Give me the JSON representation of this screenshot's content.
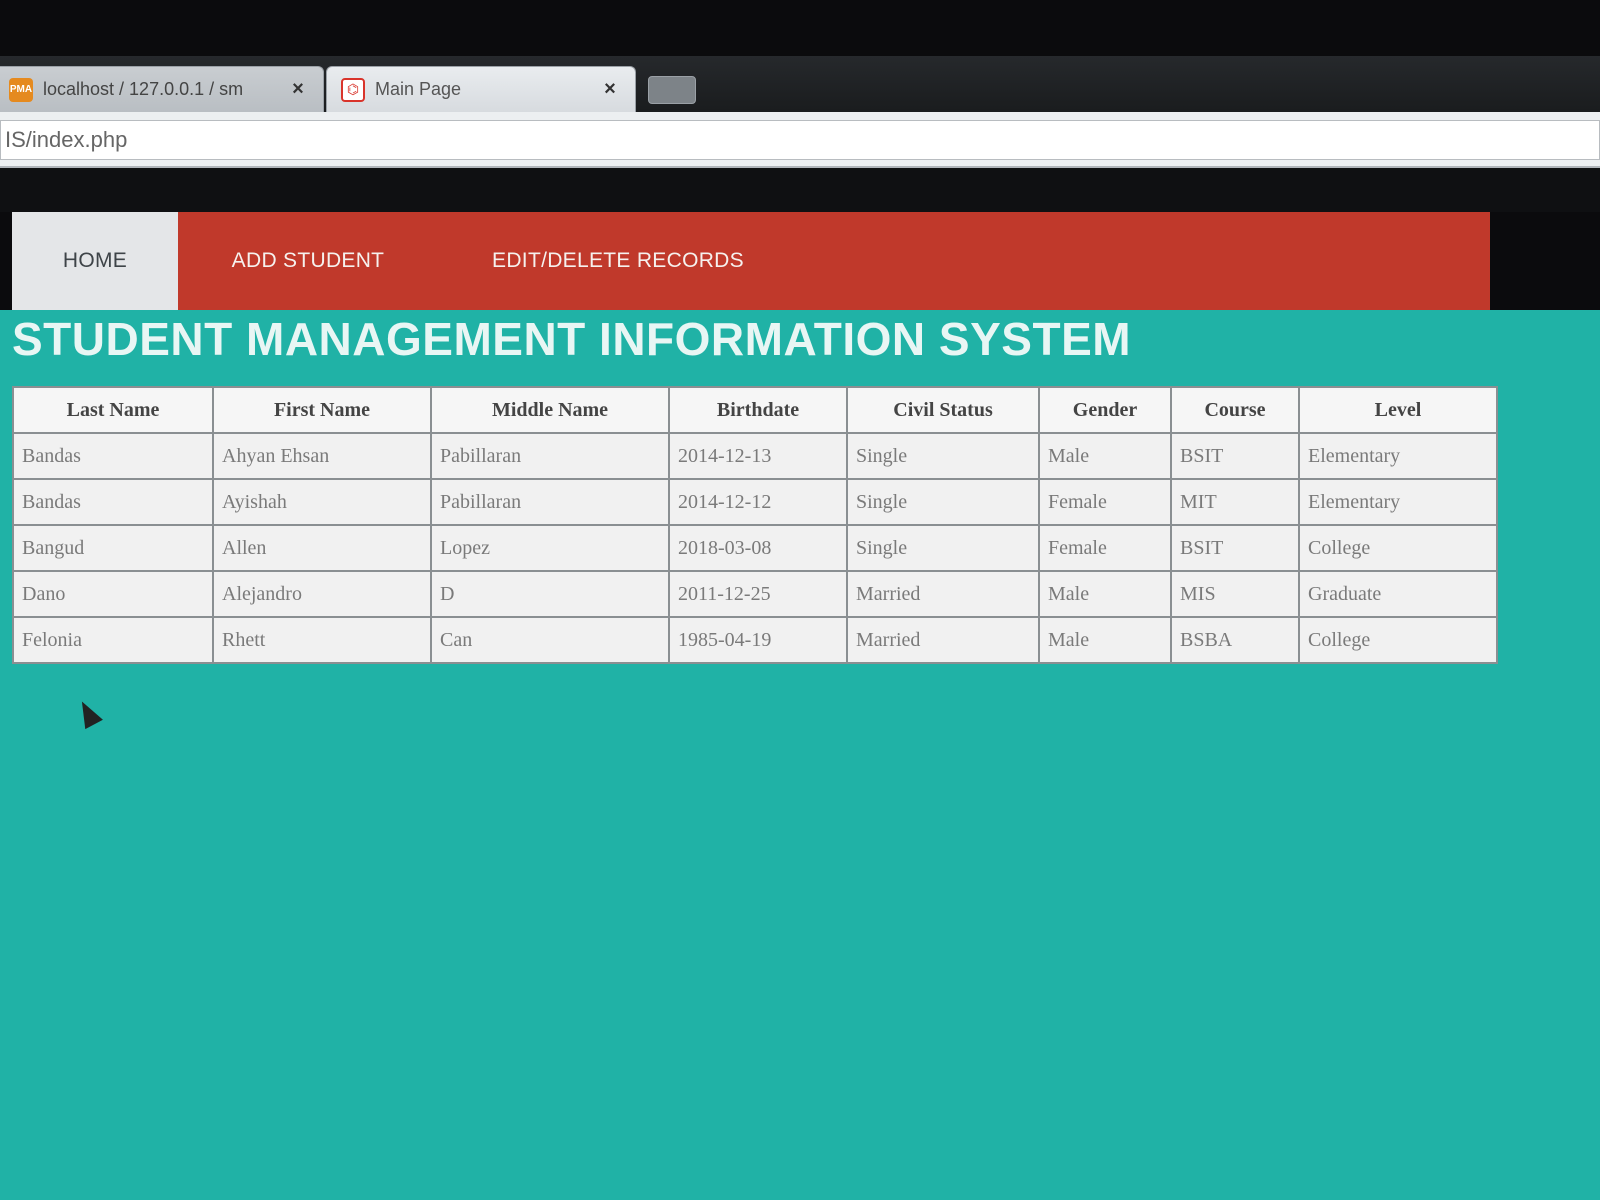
{
  "browser": {
    "tabs": [
      {
        "title": "localhost / 127.0.0.1 / sm",
        "favicon": "pma-icon"
      },
      {
        "title": "Main Page",
        "favicon": "xampp-icon"
      }
    ],
    "close_glyph": "×",
    "address": "IS/index.php"
  },
  "nav": {
    "home": "HOME",
    "add": "ADD STUDENT",
    "edit": "EDIT/DELETE RECORDS"
  },
  "page": {
    "title": "STUDENT MANAGEMENT INFORMATION SYSTEM"
  },
  "table": {
    "headers": [
      "Last Name",
      "First Name",
      "Middle Name",
      "Birthdate",
      "Civil Status",
      "Gender",
      "Course",
      "Level"
    ],
    "rows": [
      [
        "Bandas",
        "Ahyan Ehsan",
        "Pabillaran",
        "2014-12-13",
        "Single",
        "Male",
        "BSIT",
        "Elementary"
      ],
      [
        "Bandas",
        "Ayishah",
        "Pabillaran",
        "2014-12-12",
        "Single",
        "Female",
        "MIT",
        "Elementary"
      ],
      [
        "Bangud",
        "Allen",
        "Lopez",
        "2018-03-08",
        "Single",
        "Female",
        "BSIT",
        "College"
      ],
      [
        "Dano",
        "Alejandro",
        "D",
        "2011-12-25",
        "Married",
        "Male",
        "MIS",
        "Graduate"
      ],
      [
        "Felonia",
        "Rhett",
        "Can",
        "1985-04-19",
        "Married",
        "Male",
        "BSBA",
        "College"
      ]
    ]
  },
  "colors": {
    "nav_bg": "#c0392b",
    "page_bg": "#20b2a6",
    "home_tab_bg": "#e4e6e8"
  }
}
